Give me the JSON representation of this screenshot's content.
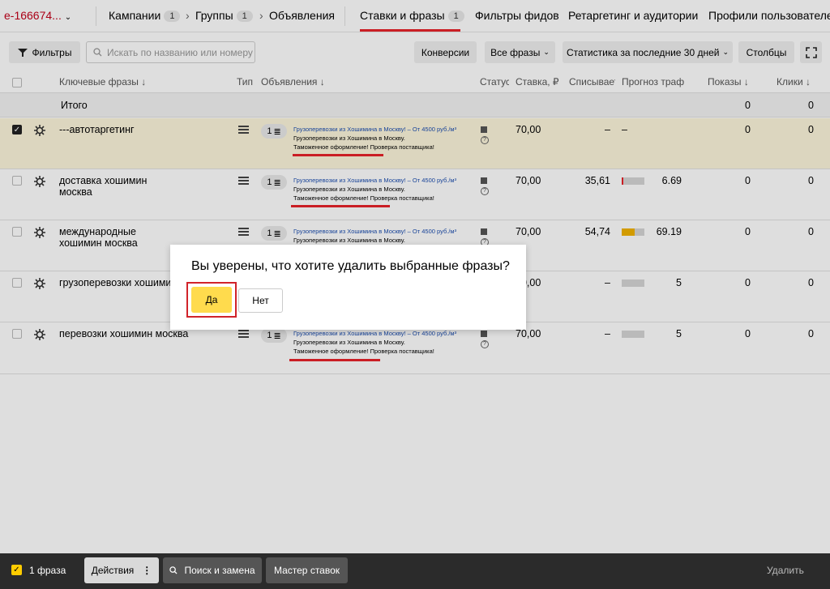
{
  "nav": {
    "account": "e-166674...",
    "campaigns": "Кампании",
    "campaigns_count": "1",
    "groups": "Группы",
    "groups_count": "1",
    "ads": "Объявления",
    "bids": "Ставки и фразы",
    "bids_count": "1",
    "feed_filters": "Фильтры фидов",
    "retargeting": "Ретаргетинг и аудитории",
    "profiles": "Профили пользователей"
  },
  "toolbar": {
    "filters": "Фильтры",
    "search_placeholder": "Искать по названию или номеру",
    "conversions": "Конверсии",
    "all_phrases": "Все фразы",
    "stats_period": "Статистика за последние 30 дней",
    "columns": "Столбцы"
  },
  "table": {
    "headers": {
      "keywords": "Ключевые фразы",
      "type": "Тип",
      "ads": "Объявления",
      "status": "Статус",
      "bid": "Ставка, ₽",
      "charged": "Списывает",
      "forecast": "Прогноз траф.",
      "impressions": "Показы",
      "clicks": "Клики"
    },
    "total": {
      "label": "Итого",
      "impressions": "0",
      "clicks": "0"
    },
    "ad_text": {
      "title": "Грузоперевозки из Хошимина в Москву! – От 4500 руб./м³",
      "line2": "Грузоперевозки из Хошимина в Москву.",
      "line3": "Таможенное оформление! Проверка поставщика!"
    },
    "rows": [
      {
        "phrase": "---автотаргетинг",
        "ads_count": "1",
        "bid": "70,00",
        "charged": "–",
        "forecast": "–",
        "impressions": "0",
        "clicks": "0",
        "fill": 0,
        "checked": true
      },
      {
        "phrase": "доставка хошимин москва",
        "ads_count": "1",
        "bid": "70,00",
        "charged": "35,61",
        "forecast": "6.69",
        "impressions": "0",
        "clicks": "0",
        "fill": 0.07,
        "checked": false
      },
      {
        "phrase": "международные хошимин москва",
        "ads_count": "1",
        "bid": "70,00",
        "charged": "54,74",
        "forecast": "69.19",
        "impressions": "0",
        "clicks": "0",
        "fill": 0.69,
        "checked": false
      },
      {
        "phrase": "грузоперевозки хошимин",
        "ads_count": "1",
        "bid": "70,00",
        "charged": "–",
        "forecast": "5",
        "impressions": "0",
        "clicks": "0",
        "fill": 0,
        "checked": false
      },
      {
        "phrase": "перевозки хошимин москва",
        "ads_count": "1",
        "bid": "70,00",
        "charged": "–",
        "forecast": "5",
        "impressions": "0",
        "clicks": "0",
        "fill": 0,
        "checked": false
      }
    ]
  },
  "dialog": {
    "question": "Вы уверены, что хотите удалить выбранные фразы?",
    "yes": "Да",
    "no": "Нет"
  },
  "bottom": {
    "selected": "1 фраза",
    "actions": "Действия",
    "search_replace": "Поиск и замена",
    "bid_wizard": "Мастер ставок",
    "delete": "Удалить"
  },
  "colors": {
    "accent_red": "#e8232a",
    "yellow": "#ffdb4d",
    "link_blue": "#1d4fb0"
  }
}
